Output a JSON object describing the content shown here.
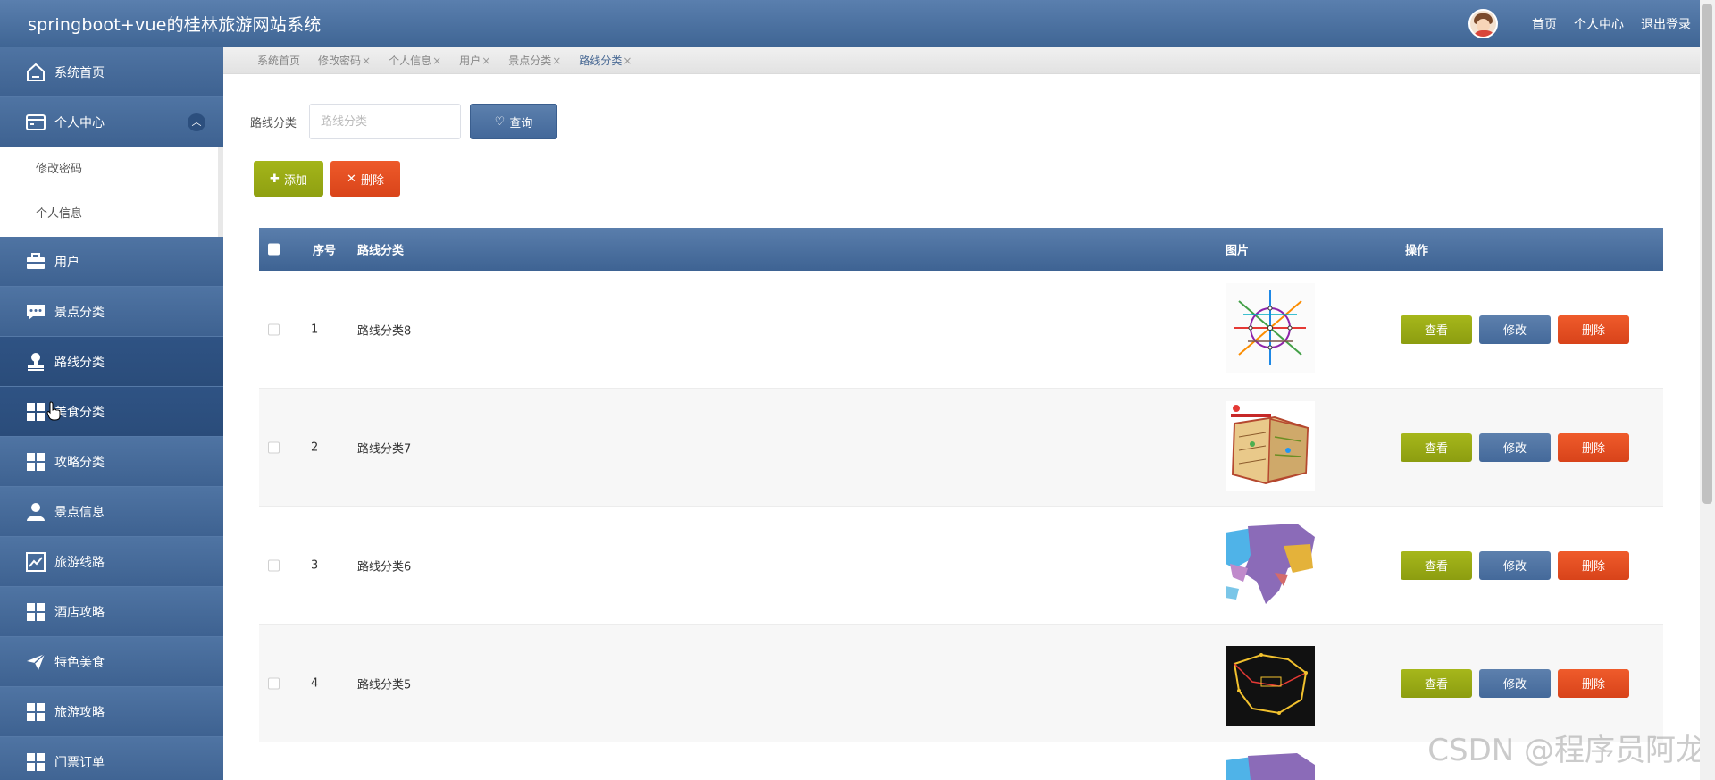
{
  "app": {
    "title": "springboot+vue的桂林旅游网站系统"
  },
  "header": {
    "links": [
      "首页",
      "个人中心",
      "退出登录"
    ]
  },
  "sidebar": {
    "items": [
      {
        "label": "系统首页",
        "icon": "home-icon"
      },
      {
        "label": "个人中心",
        "icon": "card-icon",
        "expanded": true,
        "children": [
          "修改密码",
          "个人信息"
        ]
      },
      {
        "label": "用户",
        "icon": "briefcase-icon"
      },
      {
        "label": "景点分类",
        "icon": "chat-icon"
      },
      {
        "label": "路线分类",
        "icon": "stamp-icon",
        "active": true
      },
      {
        "label": "美食分类",
        "icon": "grid-icon"
      },
      {
        "label": "攻略分类",
        "icon": "grid-icon"
      },
      {
        "label": "景点信息",
        "icon": "user-icon"
      },
      {
        "label": "旅游线路",
        "icon": "chart-icon"
      },
      {
        "label": "酒店攻略",
        "icon": "grid-icon"
      },
      {
        "label": "特色美食",
        "icon": "send-icon"
      },
      {
        "label": "旅游攻略",
        "icon": "grid-icon"
      },
      {
        "label": "门票订单",
        "icon": "grid-icon"
      }
    ]
  },
  "tabs": [
    {
      "label": "系统首页",
      "closable": false
    },
    {
      "label": "修改密码",
      "closable": true
    },
    {
      "label": "个人信息",
      "closable": true
    },
    {
      "label": "用户",
      "closable": true
    },
    {
      "label": "景点分类",
      "closable": true
    },
    {
      "label": "路线分类",
      "closable": true,
      "active": true
    }
  ],
  "tab_close": "×",
  "search": {
    "label": "路线分类",
    "placeholder": "路线分类",
    "button": "查询"
  },
  "actions": {
    "add": "添加",
    "delete": "删除"
  },
  "table": {
    "headers": {
      "index": "序号",
      "category": "路线分类",
      "image": "图片",
      "ops": "操作"
    },
    "rows": [
      {
        "index": "1",
        "category": "路线分类8",
        "image": "metro-map"
      },
      {
        "index": "2",
        "category": "路线分类7",
        "image": "tourist-map"
      },
      {
        "index": "3",
        "category": "路线分类6",
        "image": "asia-map"
      },
      {
        "index": "4",
        "category": "路线分类5",
        "image": "route-map-dark"
      }
    ],
    "ops": {
      "view": "查看",
      "edit": "修改",
      "delete": "删除"
    }
  },
  "watermark": "CSDN @程序员阿龙",
  "colors": {
    "header": "#46699a",
    "sidebar": "#46699a",
    "olive": "#9aab15",
    "orange": "#e44f22"
  }
}
